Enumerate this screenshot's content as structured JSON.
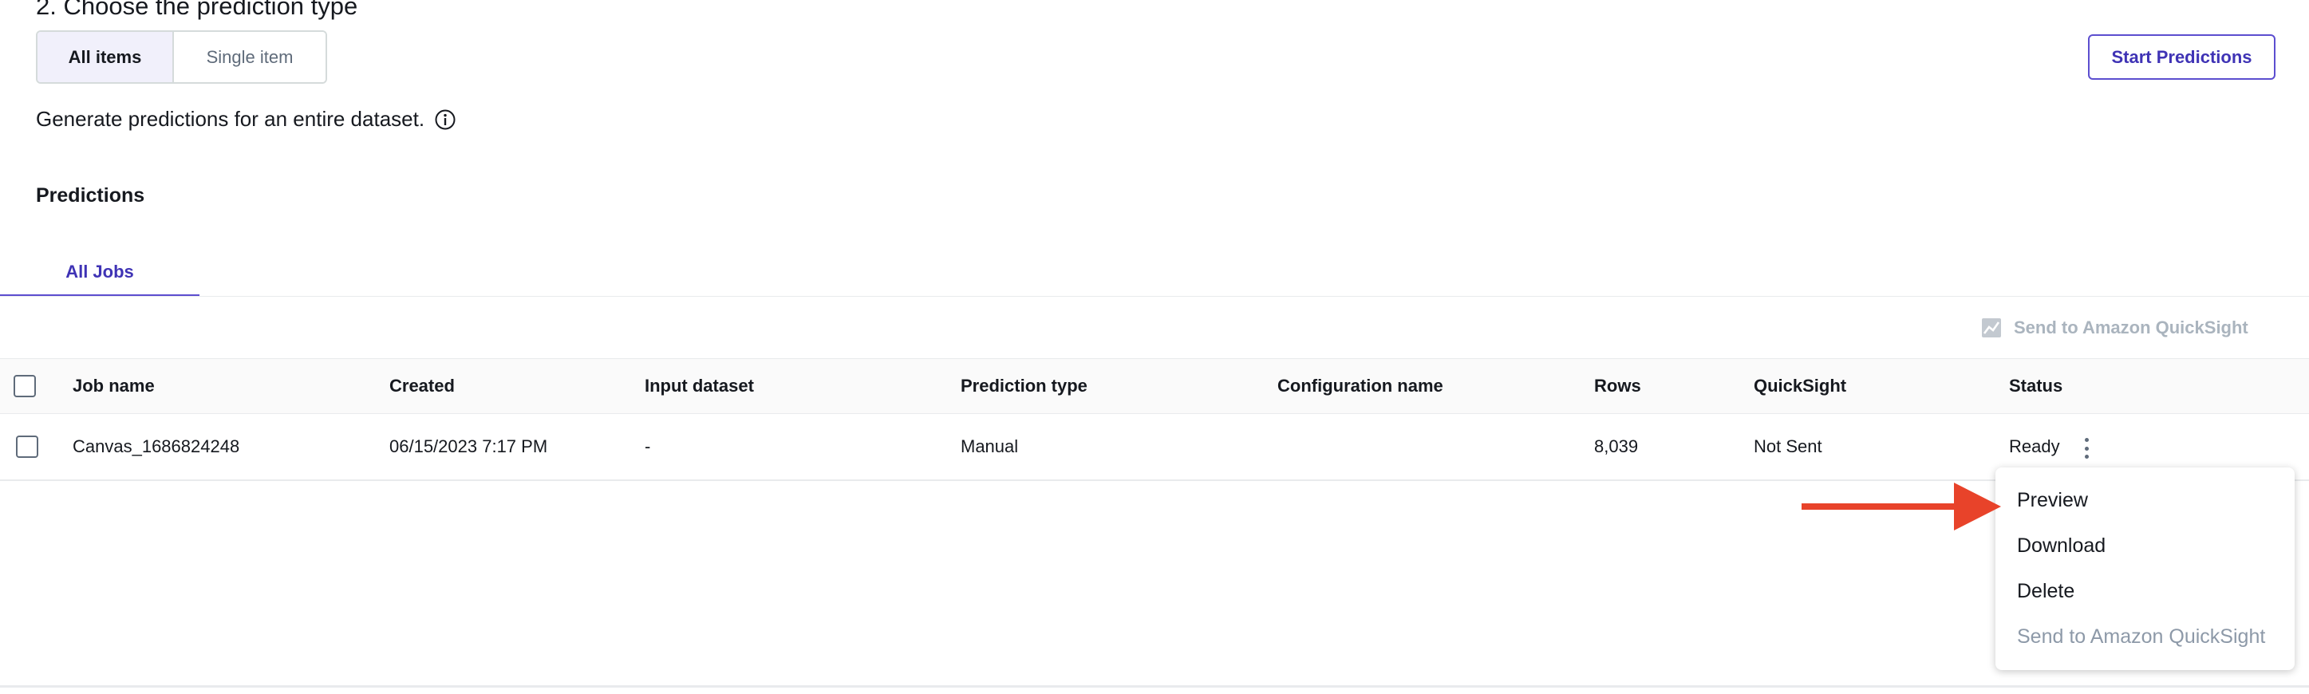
{
  "section": {
    "title": "2. Choose the prediction type",
    "segments": [
      {
        "label": "All items",
        "selected": true
      },
      {
        "label": "Single item",
        "selected": false
      }
    ],
    "description": "Generate predictions for an entire dataset.",
    "start_button": "Start Predictions"
  },
  "predictions": {
    "title": "Predictions",
    "tab": "All Jobs",
    "send_quicksight_label": "Send to Amazon QuickSight"
  },
  "table": {
    "columns": [
      "Job name",
      "Created",
      "Input dataset",
      "Prediction type",
      "Configuration name",
      "Rows",
      "QuickSight",
      "Status"
    ],
    "rows": [
      {
        "job_name": "Canvas_1686824248",
        "created": "06/15/2023 7:17 PM",
        "input_dataset": "-",
        "prediction_type": "Manual",
        "configuration_name": "",
        "rows": "8,039",
        "quicksight": "Not Sent",
        "status": "Ready"
      }
    ]
  },
  "menu": {
    "items": [
      {
        "label": "Preview",
        "disabled": false
      },
      {
        "label": "Download",
        "disabled": false
      },
      {
        "label": "Delete",
        "disabled": false
      },
      {
        "label": "Send to Amazon QuickSight",
        "disabled": true
      }
    ]
  },
  "colors": {
    "accent": "#5c4ecf",
    "accent_text": "#3f33b5",
    "annotation_arrow": "#e8432a",
    "disabled_text": "#aab4be"
  },
  "icons": [
    "info-icon",
    "quicksight-chart-icon",
    "more-vertical-icon",
    "annotation-arrow"
  ]
}
